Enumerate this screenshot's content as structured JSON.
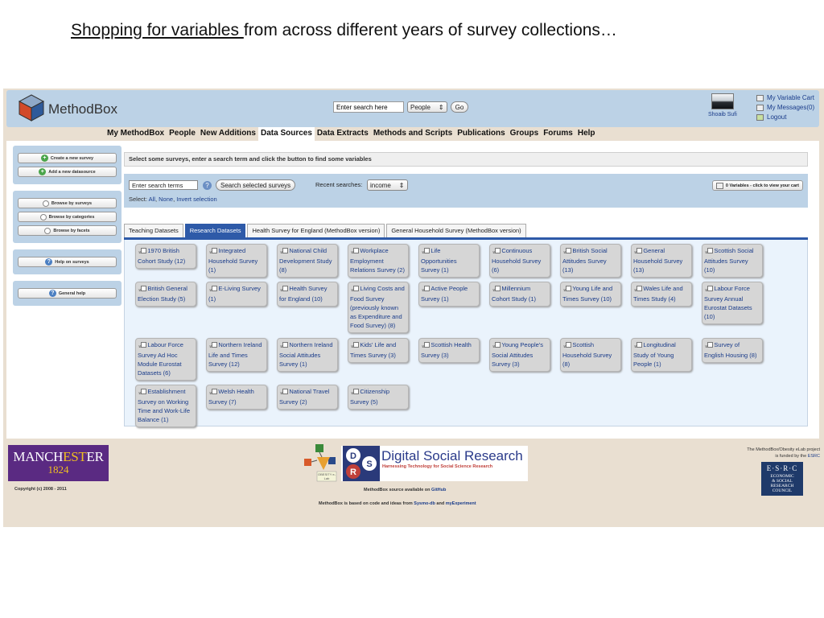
{
  "slide": {
    "title_underlined": "Shopping for variables ",
    "title_rest": "from across different years of survey collections…"
  },
  "header": {
    "logo_text": "MethodBox",
    "search_placeholder": "Enter search here",
    "search_type": "People",
    "go_label": "Go",
    "user_name": "Shoaib Sufi",
    "links": [
      "My Variable Cart",
      "My Messages(0)",
      "Logout"
    ]
  },
  "topnav": [
    "My MethodBox",
    "People",
    "New Additions",
    "Data Sources",
    "Data Extracts",
    "Methods and Scripts",
    "Publications",
    "Groups",
    "Forums",
    "Help"
  ],
  "topnav_active": "Data Sources",
  "sidebar": {
    "group1": [
      "Create a new survey",
      "Add a new datasource"
    ],
    "group2": [
      "Browse by surveys",
      "Browse by categories",
      "Browse by facets"
    ],
    "group3": [
      "Help on surveys"
    ],
    "group4": [
      "General help"
    ]
  },
  "content": {
    "instruction": "Select some surveys, enter a search term and click the button to find some variables",
    "search_terms_placeholder": "Enter search terms",
    "search_button": "Search selected surveys",
    "recent_label": "Recent searches:",
    "recent_value": "income",
    "select_label": "Select:",
    "select_all": "All",
    "select_none": "None",
    "select_invert": "Invert selection",
    "cart_label": "0 Variables - click to view your cart"
  },
  "tabs": [
    "Teaching Datasets",
    "Research Datasets",
    "Health Survey for England (MethodBox version)",
    "General Household Survey (MethodBox version)"
  ],
  "tab_active": "Research Datasets",
  "surveys": [
    "1970 British Cohort Study (12)",
    "Integrated Household Survey (1)",
    "National Child Development Study (8)",
    "Workplace Employment Relations Survey (2)",
    "Life Opportunities Survey (1)",
    "Continuous Household Survey (6)",
    "British Social Attitudes Survey (13)",
    "General Household Survey (13)",
    "Scottish Social Attitudes Survey (10)",
    "British General Election Study (5)",
    "E-Living Survey (1)",
    "Health Survey for England (10)",
    "Living Costs and Food Survey (previously known as Expenditure and Food Survey) (8)",
    "Active People Survey (1)",
    "Millennium Cohort Study (1)",
    "Young Life and Times Survey (10)",
    "Wales Life and Times Study (4)",
    "Labour Force Survey Annual Eurostat Datasets (10)",
    "Labour Force Survey Ad Hoc Module Eurostat Datasets (6)",
    "Northern Ireland Life and Times Survey (12)",
    "Northern Ireland Social Attitudes Survey (1)",
    "Kids' Life and Times Survey (3)",
    "Scottish Health Survey (3)",
    "Young People's Social Attitudes Survey (3)",
    "Scottish Household Survey (8)",
    "Longitudinal Study of Young People (1)",
    "Survey of English Housing (8)",
    "Establishment Survey on Working Time and Work-Life Balance (1)",
    "Welsh Health Survey (7)",
    "National Travel Survey (2)",
    "Citizenship Survey (5)"
  ],
  "footer": {
    "manchester_1": "MANCH",
    "manchester_highlight": "EST",
    "manchester_2": "ER",
    "manchester_year": "1824",
    "copyright": "Copyright (c) 2008 - 2011",
    "obesity_label": "OBESITY e-Lab",
    "dsr_title": "Digital Social Research",
    "dsr_sub": "Harnessing Technology for Social Science Research",
    "source_prefix": "MethodBox source available on ",
    "source_link": "GitHub",
    "based_prefix": "MethodBox is based on code and ideas from ",
    "based_link1": "Sysmo-db",
    "based_and": " and ",
    "based_link2": "myExperiment",
    "funded_text": "The MethodBox/Obesity eLab project is funded by the ",
    "funded_link": "ESRC",
    "esrc_letters": "E·S·R·C",
    "esrc_words": [
      "ECONOMIC",
      "& SOCIAL",
      "RESEARCH",
      "COUNCIL"
    ]
  },
  "colors": {
    "header_blue": "#bcd2e6",
    "tab_active": "#2e5aa8",
    "link_blue": "#1a3c8a",
    "manchester_purple": "#5a2a82",
    "esrc_navy": "#1f3a6a"
  }
}
